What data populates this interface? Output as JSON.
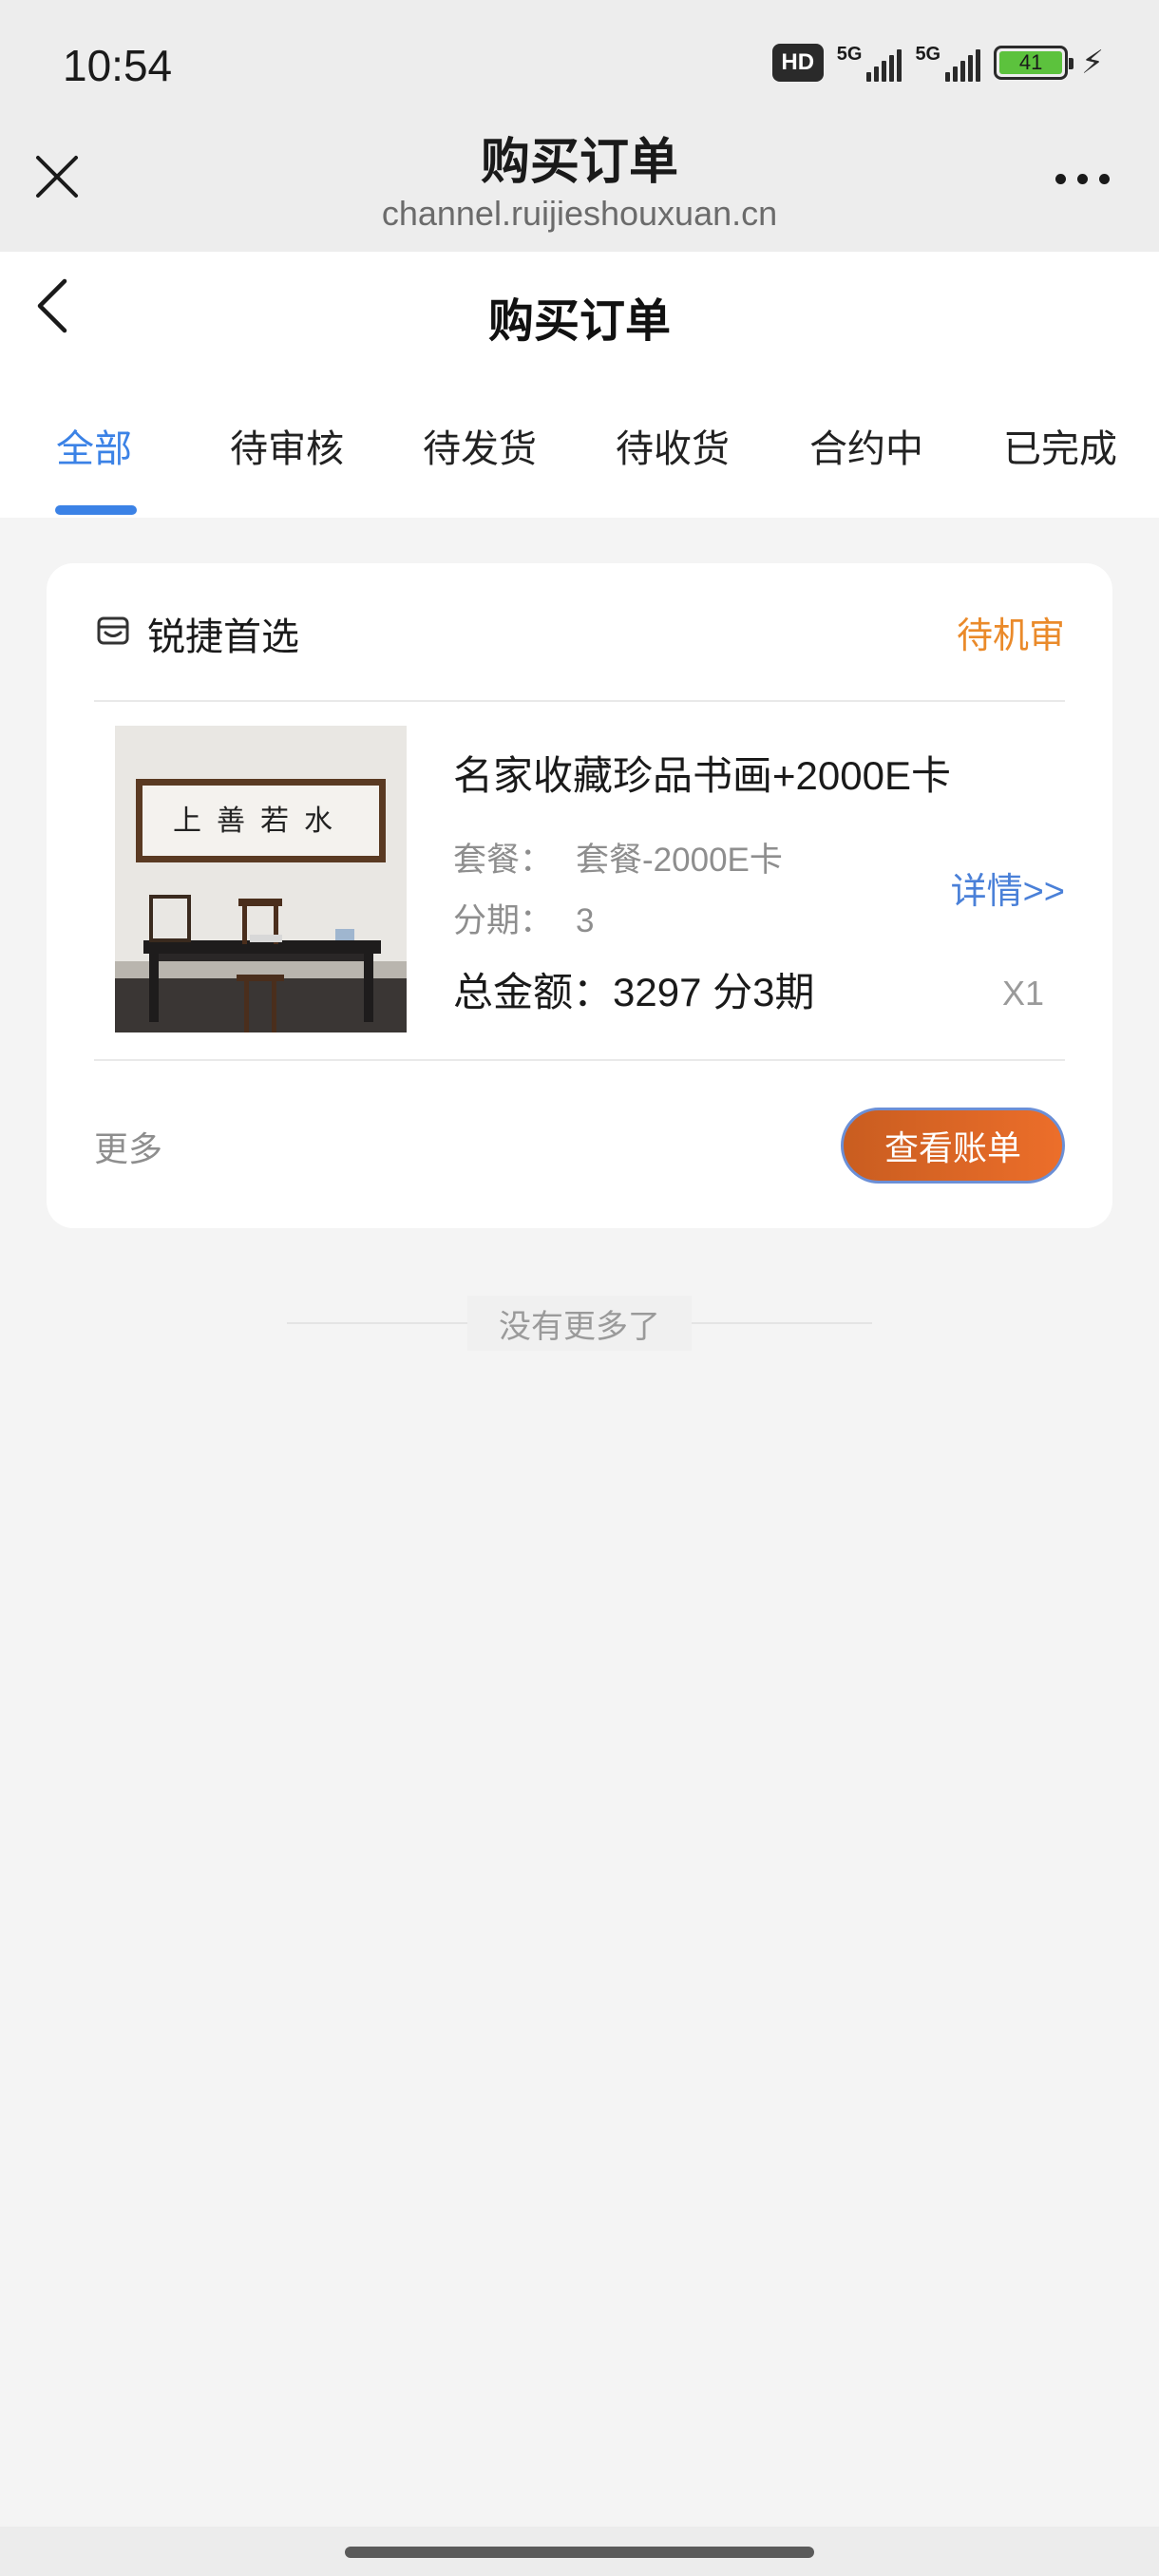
{
  "status_bar": {
    "time": "10:54",
    "hd_badge": "HD",
    "network_1": "5G",
    "network_2": "5G",
    "battery_level": "41",
    "charging_icon": "bolt-icon"
  },
  "browser": {
    "title": "购买订单",
    "url": "channel.ruijieshouxuan.cn",
    "close_icon": "close-icon",
    "more_icon": "more-icon"
  },
  "page": {
    "title": "购买订单",
    "back_icon": "chevron-left-icon",
    "tabs": [
      {
        "label": "全部",
        "active": true
      },
      {
        "label": "待审核",
        "active": false
      },
      {
        "label": "待发货",
        "active": false
      },
      {
        "label": "待收货",
        "active": false
      },
      {
        "label": "合约中",
        "active": false
      },
      {
        "label": "已完成",
        "active": false
      }
    ]
  },
  "order": {
    "shop_icon": "shop-icon",
    "shop_name": "锐捷首选",
    "status": "待机审",
    "product_name": "名家收藏珍品书画+2000E卡",
    "package_label": "套餐：",
    "package_value": "套餐-2000E卡",
    "installment_label": "分期：",
    "installment_value": "3",
    "total_label": "总金额：",
    "total_value": "3297 分3期",
    "detail_link": "详情>>",
    "quantity": "X1",
    "more_label": "更多",
    "bill_button": "查看账单",
    "painting_text": "上善若水"
  },
  "footer": {
    "end_text": "没有更多了"
  },
  "colors": {
    "accent_blue": "#3b82e6",
    "status_orange": "#ea8a2a",
    "button_orange": "#e0672a",
    "link_blue": "#4a80d8"
  }
}
